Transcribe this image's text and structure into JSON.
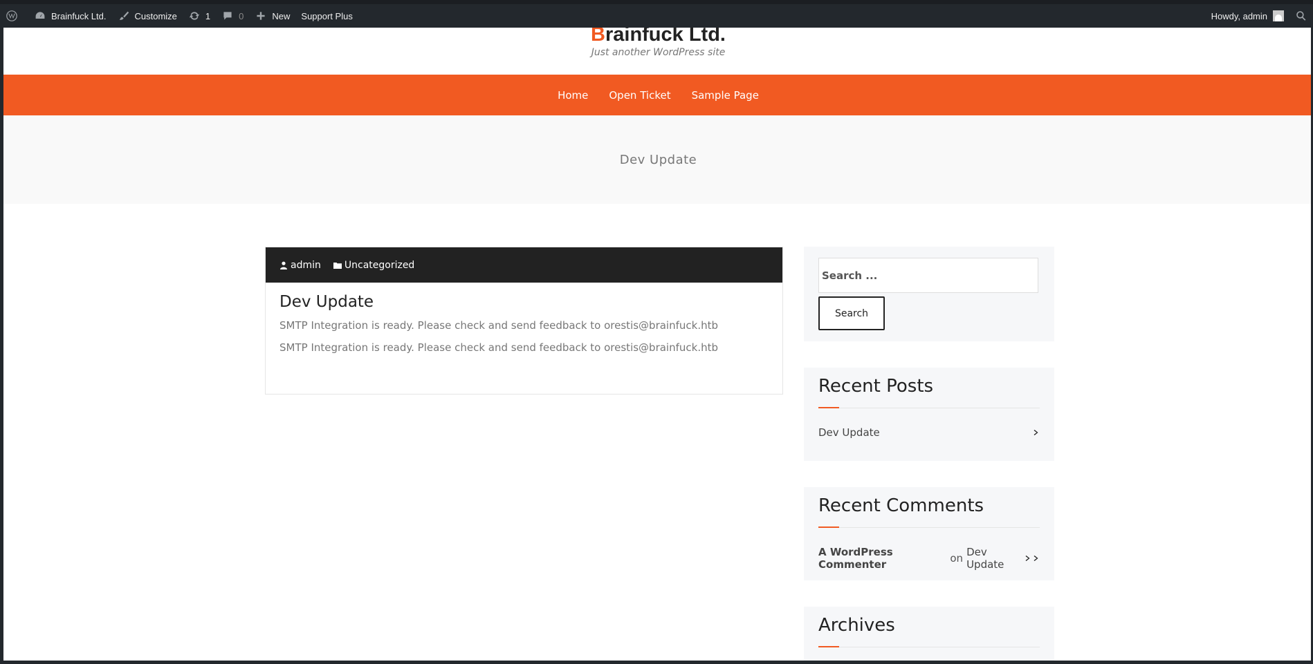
{
  "adminbar": {
    "site_name": "Brainfuck Ltd.",
    "customize": "Customize",
    "updates_count": "1",
    "comments_count": "0",
    "new": "New",
    "support_plus": "Support Plus",
    "howdy": "Howdy, admin"
  },
  "header": {
    "title_first": "B",
    "title_rest": "rainfuck Ltd.",
    "tagline": "Just another WordPress site"
  },
  "nav": {
    "items": [
      "Home",
      "Open Ticket",
      "Sample Page"
    ]
  },
  "banner": {
    "title": "Dev Update"
  },
  "post": {
    "author": "admin",
    "category": "Uncategorized",
    "title": "Dev Update",
    "paragraphs": [
      "SMTP Integration is ready. Please check and send feedback to orestis@brainfuck.htb",
      "SMTP Integration is ready. Please check and send feedback to orestis@brainfuck.htb"
    ]
  },
  "sidebar": {
    "search": {
      "placeholder": "Search ...",
      "button": "Search"
    },
    "recent_posts": {
      "title": "Recent Posts",
      "items": [
        "Dev Update"
      ]
    },
    "recent_comments": {
      "title": "Recent Comments",
      "author": "A WordPress Commenter",
      "on": "on",
      "post": "Dev Update"
    },
    "archives": {
      "title": "Archives"
    }
  },
  "colors": {
    "accent": "#f15a22",
    "adminbar": "#23282d",
    "meta_bar": "#222222"
  }
}
